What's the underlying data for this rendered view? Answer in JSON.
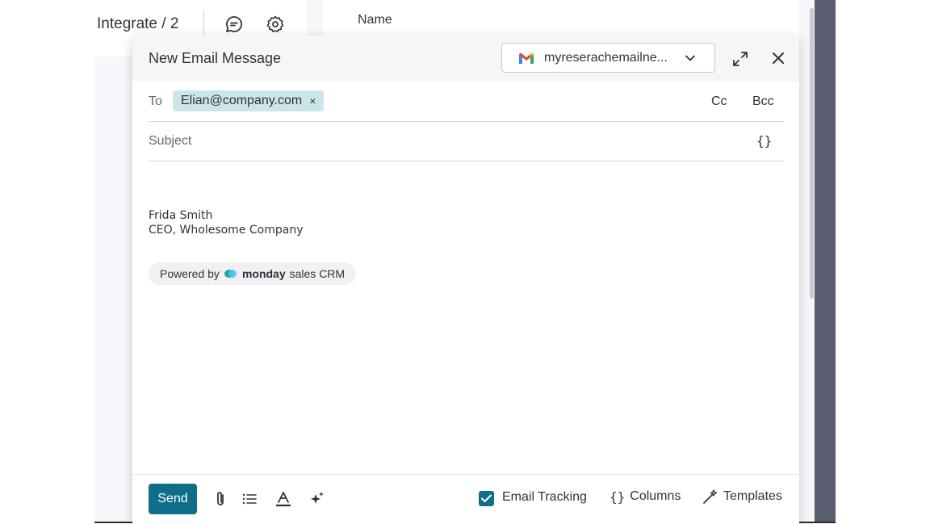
{
  "background": {
    "title": "Integrate / 2",
    "column_header": "Name"
  },
  "modal": {
    "title": "New Email Message",
    "account": "myreserachemailne...",
    "to_label": "To",
    "recipient": "Elian@company.com",
    "remove_symbol": "×",
    "cc_label": "Cc",
    "bcc_label": "Bcc",
    "subject_placeholder": "Subject",
    "variables_symbol": "{}",
    "signature": {
      "name": "Frida Smith",
      "title": "CEO, Wholesome Company"
    },
    "powered_by": {
      "prefix": "Powered by",
      "brand": "monday",
      "suffix": "sales CRM"
    }
  },
  "footer": {
    "send_label": "Send",
    "tracking_label": "Email Tracking",
    "tracking_checked": true,
    "columns_label": "Columns",
    "columns_symbol": "{}",
    "templates_label": "Templates"
  },
  "colors": {
    "accent": "#0f6f8a",
    "chip": "#cce5e9",
    "header": "#f5f6f8"
  }
}
